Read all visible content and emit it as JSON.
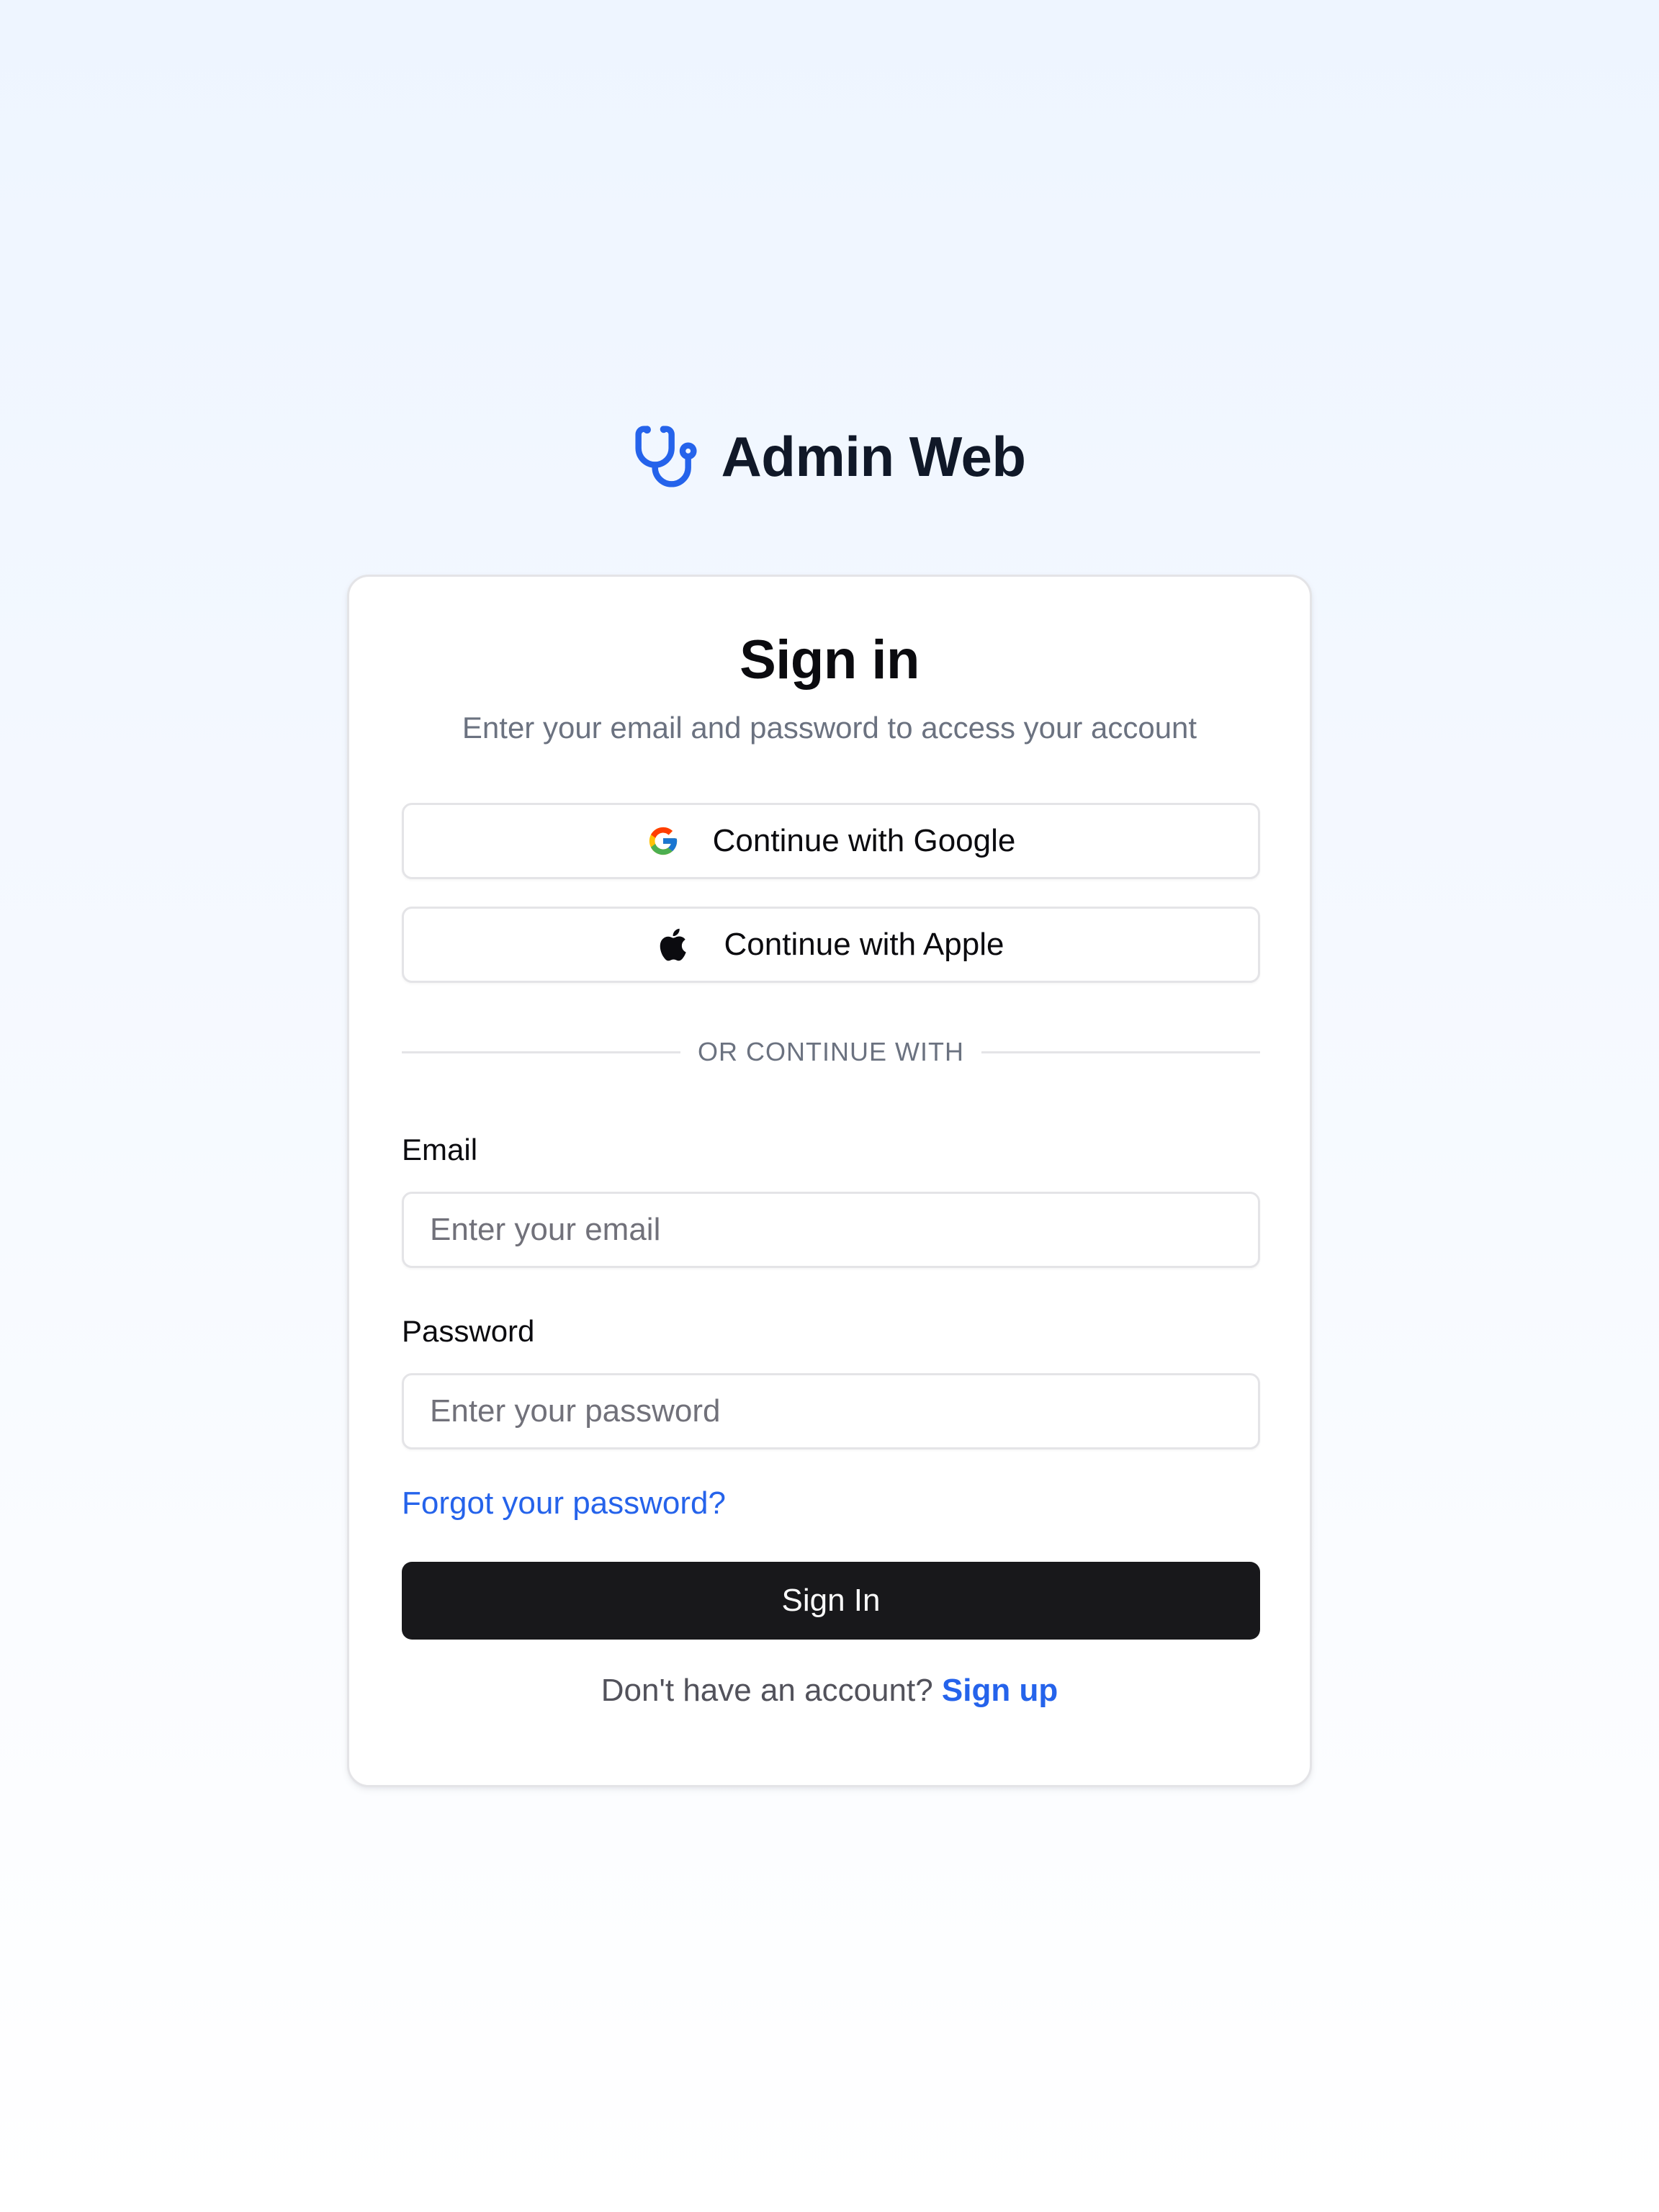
{
  "brand": {
    "title": "Admin Web",
    "icon": "stethoscope-icon",
    "accent_color": "#2563eb"
  },
  "card": {
    "title": "Sign in",
    "subtitle": "Enter your email and password to access your account"
  },
  "social": {
    "google_label": "Continue with Google",
    "google_icon": "google-icon",
    "apple_label": "Continue with Apple",
    "apple_icon": "apple-icon"
  },
  "divider": {
    "text": "OR CONTINUE WITH"
  },
  "form": {
    "email_label": "Email",
    "email_placeholder": "Enter your email",
    "email_value": "",
    "password_label": "Password",
    "password_placeholder": "Enter your password",
    "password_value": "",
    "forgot_label": "Forgot your password?",
    "submit_label": "Sign In",
    "submit_color": "#18181b"
  },
  "footer": {
    "prompt": "Don't have an account?",
    "signup_label": "Sign up",
    "link_color": "#2563eb"
  }
}
